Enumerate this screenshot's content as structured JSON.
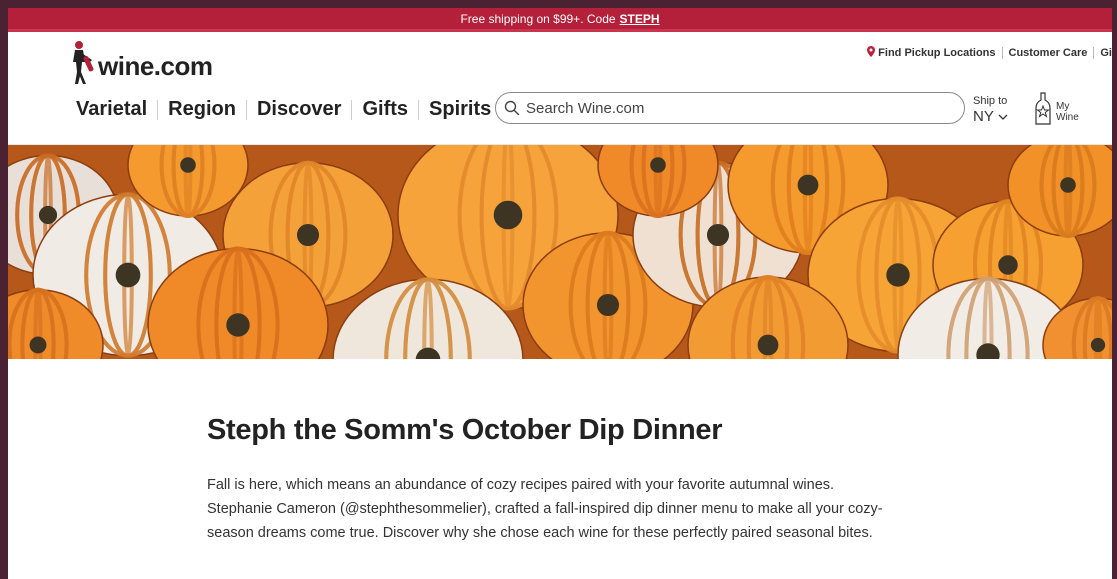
{
  "promo": {
    "text": "Free shipping on $99+. Code",
    "code": "STEPH"
  },
  "header": {
    "logo_text": "wine.com",
    "utility_links": {
      "pickup": "Find Pickup Locations",
      "care": "Customer Care",
      "overflow": "Gi"
    },
    "nav": [
      "Varietal",
      "Region",
      "Discover",
      "Gifts",
      "Spirits"
    ],
    "search_placeholder": "Search Wine.com",
    "ship_to_label": "Ship to",
    "ship_to_state": "NY",
    "my_wine_line1": "My",
    "my_wine_line2": "Wine"
  },
  "colors": {
    "brand_red": "#b41f3a",
    "frame": "#4a2232"
  },
  "article": {
    "title": "Steph the Somm's October Dip Dinner",
    "body": "Fall is here, which means an abundance of cozy recipes paired with your favorite autumnal wines. Stephanie Cameron (@stephthesommelier), crafted a fall-inspired dip dinner menu to make all your cozy-season dreams come true. Discover why she chose each wine for these perfectly paired seasonal bites."
  }
}
